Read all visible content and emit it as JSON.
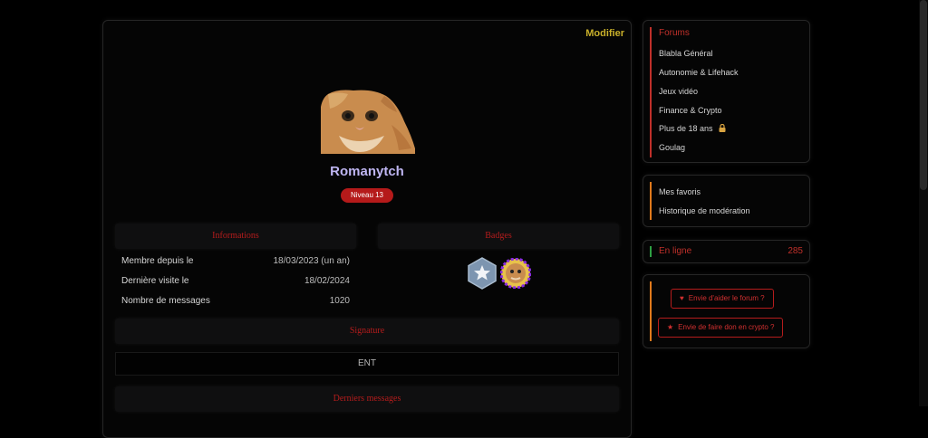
{
  "profile": {
    "edit_label": "Modifier",
    "username": "Romanytch",
    "level": "Niveau 13"
  },
  "sections": {
    "informations": "Informations",
    "badges": "Badges",
    "signature": "Signature",
    "latest_messages": "Derniers messages"
  },
  "info": [
    {
      "label": "Membre depuis le",
      "value": "18/03/2023 (un an)"
    },
    {
      "label": "Dernière visite le",
      "value": "18/02/2024"
    },
    {
      "label": "Nombre de messages",
      "value": "1020"
    }
  ],
  "signature_text": "ENT",
  "sidebar": {
    "forums_title": "Forums",
    "forums": [
      "Blabla Général",
      "Autonomie & Lifehack",
      "Jeux vidéo",
      "Finance & Crypto",
      "Plus de 18 ans",
      "Goulag"
    ],
    "links": [
      "Mes favoris",
      "Historique de modération"
    ],
    "online_label": "En ligne",
    "online_count": "285",
    "support_buttons": [
      {
        "label": "Envie d'aider le forum ?",
        "icon": "heart-icon"
      },
      {
        "label": "Envie de faire don en crypto ?",
        "icon": "star-icon"
      }
    ]
  },
  "colors": {
    "accent_red": "#c0302a",
    "accent_orange": "#e07a1c",
    "online_green": "#2ea043",
    "username": "#bfb6f2",
    "edit_gold": "#c9b02a"
  }
}
